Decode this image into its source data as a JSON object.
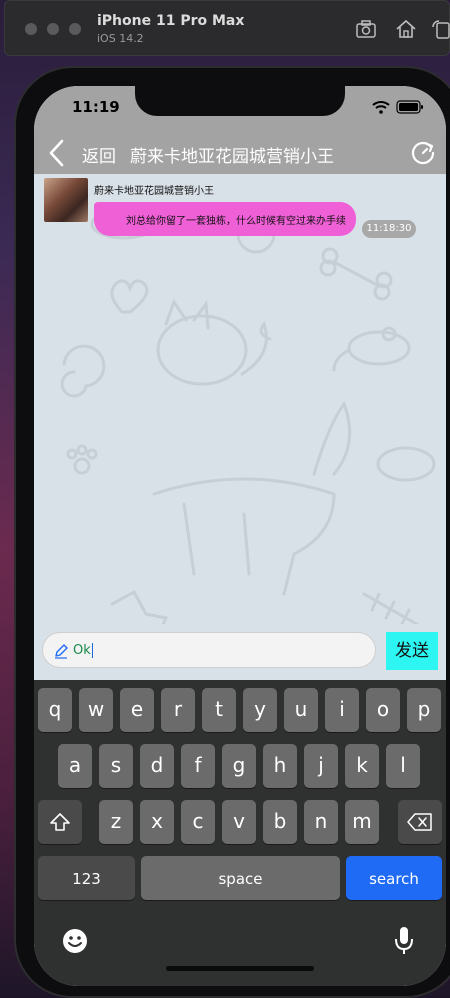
{
  "simulator": {
    "title": "iPhone 11 Pro Max",
    "subtitle": "iOS 14.2",
    "icons": [
      "screenshot-icon",
      "home-icon",
      "rotate-icon"
    ]
  },
  "status_bar": {
    "time": "11:19",
    "icons": [
      "wifi-icon",
      "battery-icon"
    ]
  },
  "nav": {
    "back_label": "返回",
    "title": "蔚来卡地亚花园城营销小王",
    "right_icon": "refresh-icon"
  },
  "chat": {
    "messages": [
      {
        "sender": "蔚来卡地亚花园城营销小王",
        "text": "刘总给你留了一套独栋，什么时候有空过来办手续",
        "time": "11:18:30",
        "bubble_color": "#ef5fd6"
      }
    ]
  },
  "composer": {
    "value": "Ok",
    "send_label": "发送",
    "send_color": "#2df6f2"
  },
  "keyboard": {
    "row1": [
      "q",
      "w",
      "e",
      "r",
      "t",
      "y",
      "u",
      "i",
      "o",
      "p"
    ],
    "row2": [
      "a",
      "s",
      "d",
      "f",
      "g",
      "h",
      "j",
      "k",
      "l"
    ],
    "row3": [
      "z",
      "x",
      "c",
      "v",
      "b",
      "n",
      "m"
    ],
    "numbers_label": "123",
    "space_label": "space",
    "action_label": "search",
    "action_color": "#1f6bf5"
  }
}
